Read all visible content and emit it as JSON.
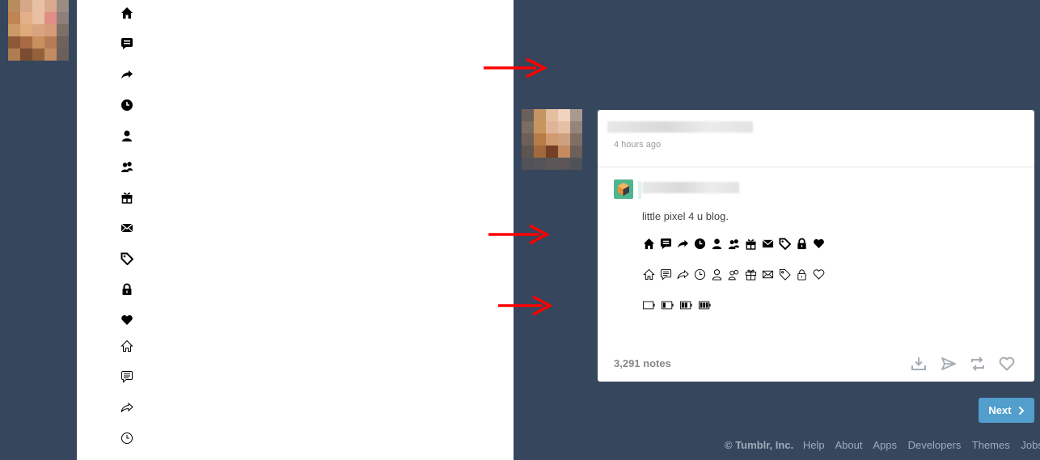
{
  "post": {
    "time": "4 hours ago",
    "text": "little pixel 4 u blog.",
    "notes": "3,291 notes"
  },
  "icons": {
    "solid": [
      "home-icon",
      "chat-icon",
      "share-icon",
      "clock-icon",
      "user-icon",
      "users-icon",
      "gift-icon",
      "mail-icon",
      "tag-icon",
      "lock-icon",
      "heart-icon"
    ],
    "outline": [
      "home-outline-icon",
      "chat-outline-icon",
      "share-outline-icon",
      "clock-outline-icon"
    ],
    "battery_levels": [
      0,
      0.33,
      0.66,
      1
    ]
  },
  "pagination": {
    "next_label": "Next"
  },
  "footer": {
    "copyright": "© Tumblr, Inc.",
    "links": [
      "Help",
      "About",
      "Apps",
      "Developers",
      "Themes",
      "Jobs"
    ]
  },
  "colors": {
    "background": "#36465d",
    "arrow": "#ff0000",
    "next_button": "#529ecc",
    "card": "#ffffff"
  }
}
